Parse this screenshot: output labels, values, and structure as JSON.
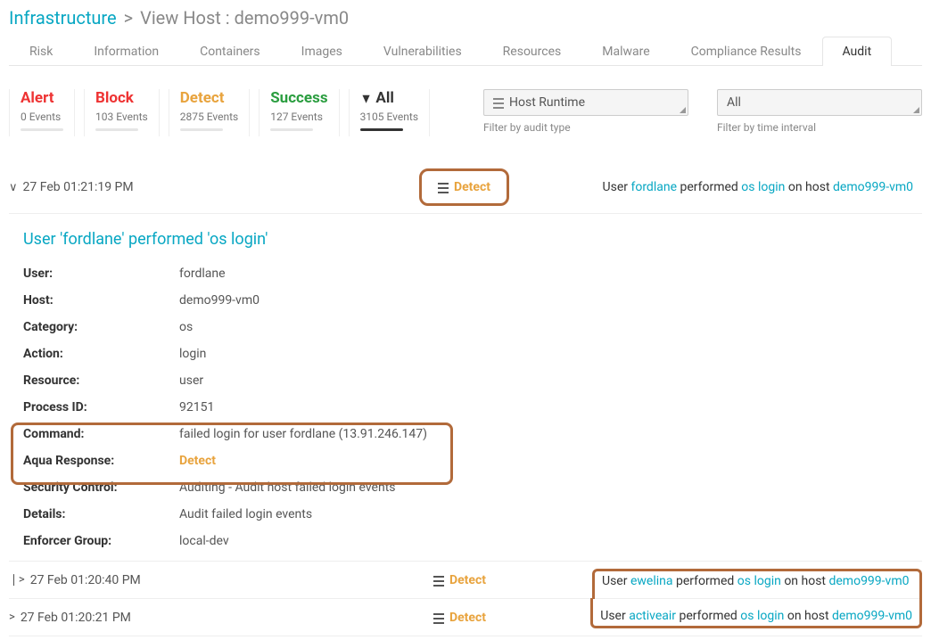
{
  "breadcrumb": {
    "root": "Infrastructure",
    "sep": ">",
    "current": "View Host : demo999-vm0"
  },
  "tabs": {
    "risk": "Risk",
    "information": "Information",
    "containers": "Containers",
    "images": "Images",
    "vulnerabilities": "Vulnerabilities",
    "resources": "Resources",
    "malware": "Malware",
    "compliance": "Compliance Results",
    "audit": "Audit"
  },
  "filter_tabs": {
    "alert": {
      "title": "Alert",
      "count": "0 Events"
    },
    "block": {
      "title": "Block",
      "count": "103 Events"
    },
    "detect": {
      "title": "Detect",
      "count": "2875 Events"
    },
    "success": {
      "title": "Success",
      "count": "127 Events"
    },
    "all": {
      "title": "All",
      "count": "3105 Events"
    }
  },
  "selects": {
    "type": {
      "value": "Host Runtime",
      "caption": "Filter by audit type"
    },
    "interval": {
      "value": "All",
      "caption": "Filter by time interval"
    }
  },
  "rows": {
    "r0": {
      "timestamp": "27 Feb 01:21:19 PM",
      "pill": "Detect",
      "summary": {
        "pre": "User ",
        "user": "fordlane",
        "mid": " performed  ",
        "action": "os login",
        "post": "  on host ",
        "host": "demo999-vm0"
      }
    },
    "r1": {
      "timestamp": "27 Feb 01:20:40 PM",
      "pill": "Detect",
      "summary": {
        "pre": "User ",
        "user": "ewelina",
        "mid": " performed  ",
        "action": "os login",
        "post": "  on host ",
        "host": "demo999-vm0"
      }
    },
    "r2": {
      "timestamp": "27 Feb 01:20:21 PM",
      "pill": "Detect",
      "summary": {
        "pre": "User ",
        "user": "activeair",
        "mid": " performed  ",
        "action": "os login",
        "post": "  on host ",
        "host": "demo999-vm0"
      }
    }
  },
  "panel": {
    "title": "User 'fordlane' performed 'os login'",
    "labels": {
      "user": "User:",
      "host": "Host:",
      "category": "Category:",
      "action": "Action:",
      "resource": "Resource:",
      "process_id": "Process ID:",
      "command": "Command:",
      "aqua_response": "Aqua Response:",
      "security_control": "Security Control:",
      "details": "Details:",
      "enforcer_group": "Enforcer Group:"
    },
    "values": {
      "user": "fordlane",
      "host": "demo999-vm0",
      "category": "os",
      "action": "login",
      "resource": "user",
      "process_id": "92151",
      "command": "failed login for user fordlane (13.91.246.147)",
      "aqua_response": "Detect",
      "security_control": "Auditing - Audit host failed login events",
      "details": "Audit failed login events",
      "enforcer_group": "local-dev"
    }
  }
}
